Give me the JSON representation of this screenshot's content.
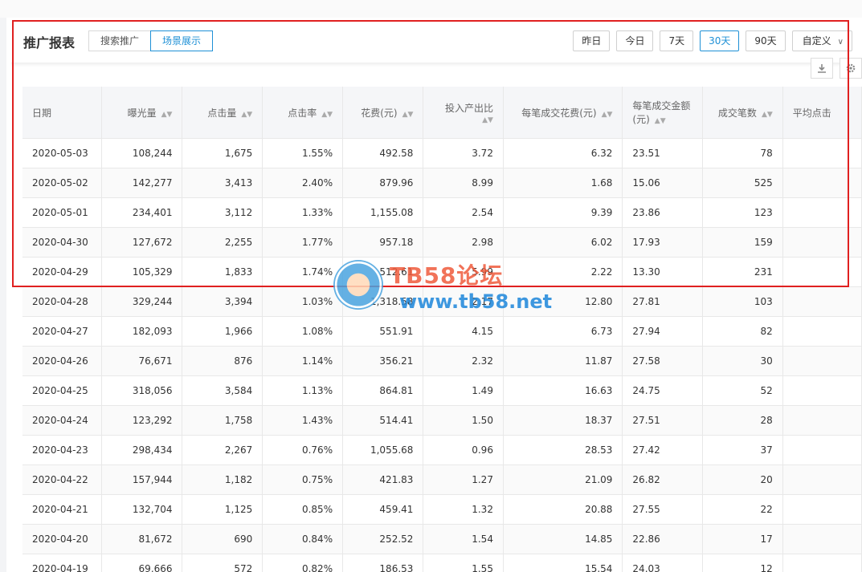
{
  "header": {
    "title": "推广报表",
    "tabs": [
      {
        "label": "搜索推广",
        "active": false
      },
      {
        "label": "场景展示",
        "active": true
      }
    ],
    "ranges": [
      {
        "label": "昨日",
        "active": false
      },
      {
        "label": "今日",
        "active": false
      },
      {
        "label": "7天",
        "active": false
      },
      {
        "label": "30天",
        "active": true
      },
      {
        "label": "90天",
        "active": false
      }
    ],
    "custom_range": "自定义",
    "tools": [
      "download-icon",
      "gear-icon"
    ]
  },
  "table": {
    "columns": [
      {
        "label": "日期",
        "sortable": false
      },
      {
        "label": "曝光量",
        "sortable": true
      },
      {
        "label": "点击量",
        "sortable": true
      },
      {
        "label": "点击率",
        "sortable": true
      },
      {
        "label": "花费(元)",
        "sortable": true
      },
      {
        "label": "投入产出比",
        "sortable": true
      },
      {
        "label": "每笔成交花费(元)",
        "sortable": true
      },
      {
        "label": "每笔成交金额(元)",
        "sortable": true
      },
      {
        "label": "成交笔数",
        "sortable": true
      },
      {
        "label": "平均点击",
        "sortable": false
      }
    ],
    "rows": [
      [
        "2020-05-03",
        "108,244",
        "1,675",
        "1.55%",
        "492.58",
        "3.72",
        "6.32",
        "23.51",
        "78",
        ""
      ],
      [
        "2020-05-02",
        "142,277",
        "3,413",
        "2.40%",
        "879.96",
        "8.99",
        "1.68",
        "15.06",
        "525",
        ""
      ],
      [
        "2020-05-01",
        "234,401",
        "3,112",
        "1.33%",
        "1,155.08",
        "2.54",
        "9.39",
        "23.86",
        "123",
        ""
      ],
      [
        "2020-04-30",
        "127,672",
        "2,255",
        "1.77%",
        "957.18",
        "2.98",
        "6.02",
        "17.93",
        "159",
        ""
      ],
      [
        "2020-04-29",
        "105,329",
        "1,833",
        "1.74%",
        "512.61",
        "5.99",
        "2.22",
        "13.30",
        "231",
        ""
      ],
      [
        "2020-04-28",
        "329,244",
        "3,394",
        "1.03%",
        "1,318.58",
        "2.17",
        "12.80",
        "27.81",
        "103",
        ""
      ],
      [
        "2020-04-27",
        "182,093",
        "1,966",
        "1.08%",
        "551.91",
        "4.15",
        "6.73",
        "27.94",
        "82",
        ""
      ],
      [
        "2020-04-26",
        "76,671",
        "876",
        "1.14%",
        "356.21",
        "2.32",
        "11.87",
        "27.58",
        "30",
        ""
      ],
      [
        "2020-04-25",
        "318,056",
        "3,584",
        "1.13%",
        "864.81",
        "1.49",
        "16.63",
        "24.75",
        "52",
        ""
      ],
      [
        "2020-04-24",
        "123,292",
        "1,758",
        "1.43%",
        "514.41",
        "1.50",
        "18.37",
        "27.51",
        "28",
        ""
      ],
      [
        "2020-04-23",
        "298,434",
        "2,267",
        "0.76%",
        "1,055.68",
        "0.96",
        "28.53",
        "27.42",
        "37",
        ""
      ],
      [
        "2020-04-22",
        "157,944",
        "1,182",
        "0.75%",
        "421.83",
        "1.27",
        "21.09",
        "26.82",
        "20",
        ""
      ],
      [
        "2020-04-21",
        "132,704",
        "1,125",
        "0.85%",
        "459.41",
        "1.32",
        "20.88",
        "27.55",
        "22",
        ""
      ],
      [
        "2020-04-20",
        "81,672",
        "690",
        "0.84%",
        "252.52",
        "1.54",
        "14.85",
        "22.86",
        "17",
        ""
      ],
      [
        "2020-04-19",
        "69,666",
        "572",
        "0.82%",
        "186.53",
        "1.55",
        "15.54",
        "24.03",
        "12",
        ""
      ]
    ]
  },
  "watermark": {
    "title": "TB58论坛",
    "url": "www.tb58.net"
  },
  "colors": {
    "accent": "#1e90d6",
    "highlight_border": "#e02020"
  }
}
